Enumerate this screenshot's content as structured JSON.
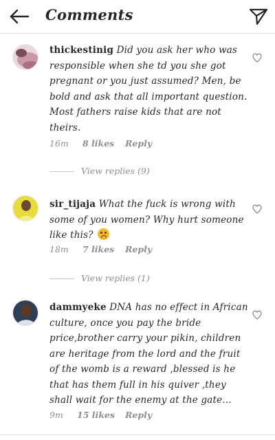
{
  "header": {
    "title": "Comments",
    "back_icon": "arrow-left-icon",
    "send_icon": "paper-plane-icon"
  },
  "comments": [
    {
      "username": "thickestinig",
      "text": "Did you ask her who was responsible when she td you she got pregnant or you just assumed? Men, be bold and ask that all important question. Most fathers raise kids that are not theirs.",
      "time": "16m",
      "likes": "8 likes",
      "reply": "Reply",
      "view_replies": "View replies (9)"
    },
    {
      "username": "sir_tijaja",
      "text": "What the fuck is wrong with some of you women? Why hurt someone like this?",
      "emoji": "sad-face-emoji",
      "time": "18m",
      "likes": "7 likes",
      "reply": "Reply",
      "view_replies": "View replies (1)"
    },
    {
      "username": "dammyeke",
      "text": "DNA has no effect in African culture, once you pay the bride price,brother carry your pikin, children are heritage from the lord and the fruit of the womb is a reward ,blessed is he that has them full in his quiver ,they shall wait for the enemy at the gate...",
      "time": "9m",
      "likes": "15 likes",
      "reply": "Reply"
    }
  ],
  "colors": {
    "text": "#262626",
    "secondary": "#8e8e8e",
    "divider": "#dbdbdb",
    "emoji": "#f5b72e"
  }
}
